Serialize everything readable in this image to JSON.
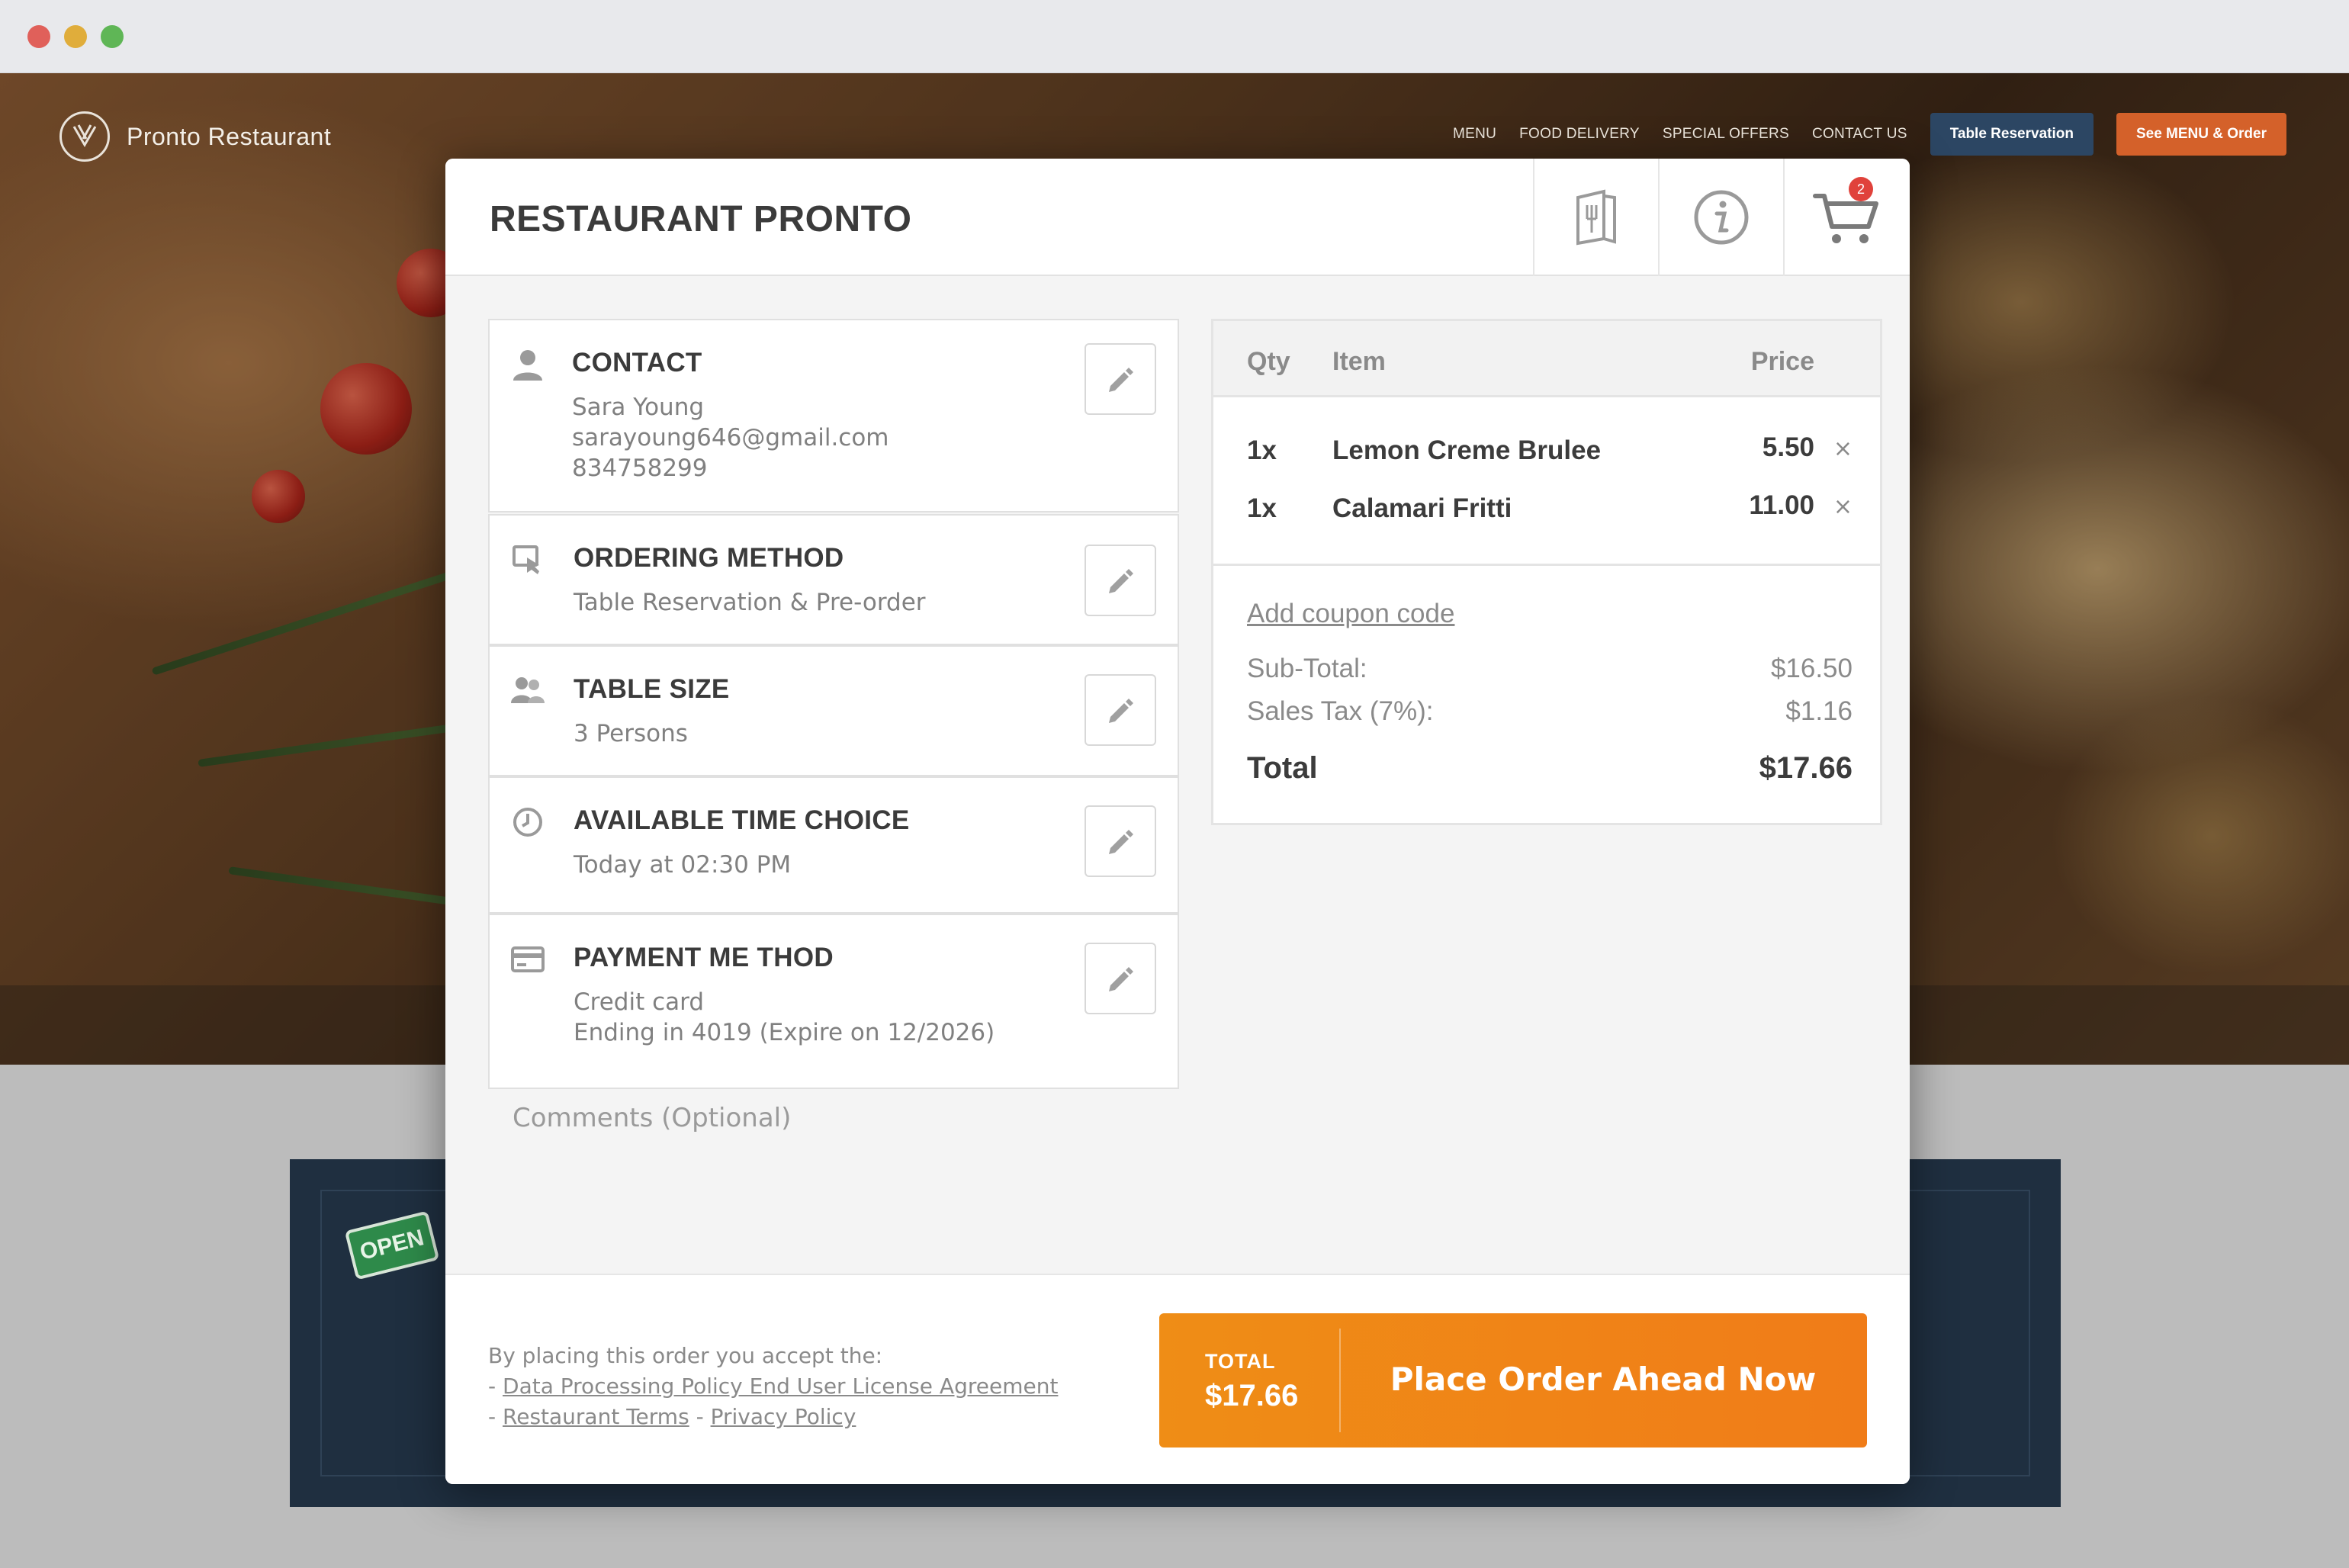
{
  "site": {
    "logo_text": "Pronto Restaurant",
    "nav": [
      "MENU",
      "FOOD DELIVERY",
      "SPECIAL OFFERS",
      "CONTACT US"
    ],
    "reserve_button": "Table Reservation",
    "order_button": "See MENU & Order",
    "open_sign": "OPEN"
  },
  "modal": {
    "title": "RESTAURANT PRONTO",
    "cart_count": "2",
    "header_icons": [
      "menu-icon",
      "info-icon",
      "cart-icon"
    ]
  },
  "details": {
    "contact": {
      "title": "CONTACT",
      "name": "Sara Young",
      "email": "sarayoung646@gmail.com",
      "phone": "834758299"
    },
    "ordering_method": {
      "title": "ORDERING METHOD",
      "value": "Table Reservation & Pre-order"
    },
    "table_size": {
      "title": "TABLE SIZE",
      "value": "3 Persons"
    },
    "time_choice": {
      "title": "AVAILABLE TIME CHOICE",
      "value": "Today at 02:30 PM"
    },
    "payment": {
      "title": "PAYMENT ME THOD",
      "method": "Credit card",
      "card": "Ending in 4019 (Expire on 12/2026)"
    },
    "comments_placeholder": "Comments (Optional)"
  },
  "summary": {
    "headers": {
      "qty": "Qty",
      "item": "Item",
      "price": "Price"
    },
    "items": [
      {
        "qty": "1x",
        "name": "Lemon Creme Brulee",
        "price": "5.50"
      },
      {
        "qty": "1x",
        "name": "Calamari Fritti",
        "price": "11.00"
      }
    ],
    "remove_glyph": "×",
    "coupon_link": "Add coupon code",
    "subtotal_label": "Sub-Total:",
    "subtotal_value": "$16.50",
    "tax_label": "Sales Tax (7%):",
    "tax_value": "$1.16",
    "total_label": "Total",
    "total_value": "$17.66"
  },
  "footer": {
    "terms_intro": "By placing this order you accept the:",
    "terms_line1_prefix": "- ",
    "terms_line1_link": "Data Processing Policy End User License Agreement",
    "terms_line2_prefix": "- ",
    "terms_line2_link1": "Restaurant Terms",
    "terms_line2_sep": " - ",
    "terms_line2_link2": "Privacy Policy",
    "button_total_label": "TOTAL",
    "button_total_value": "$17.66",
    "button_cta": "Place Order Ahead Now"
  },
  "colors": {
    "accent_orange": "#ef8d16",
    "nav_reserve": "#2c4663",
    "nav_order": "#d4612a",
    "badge_red": "#e0423b"
  }
}
